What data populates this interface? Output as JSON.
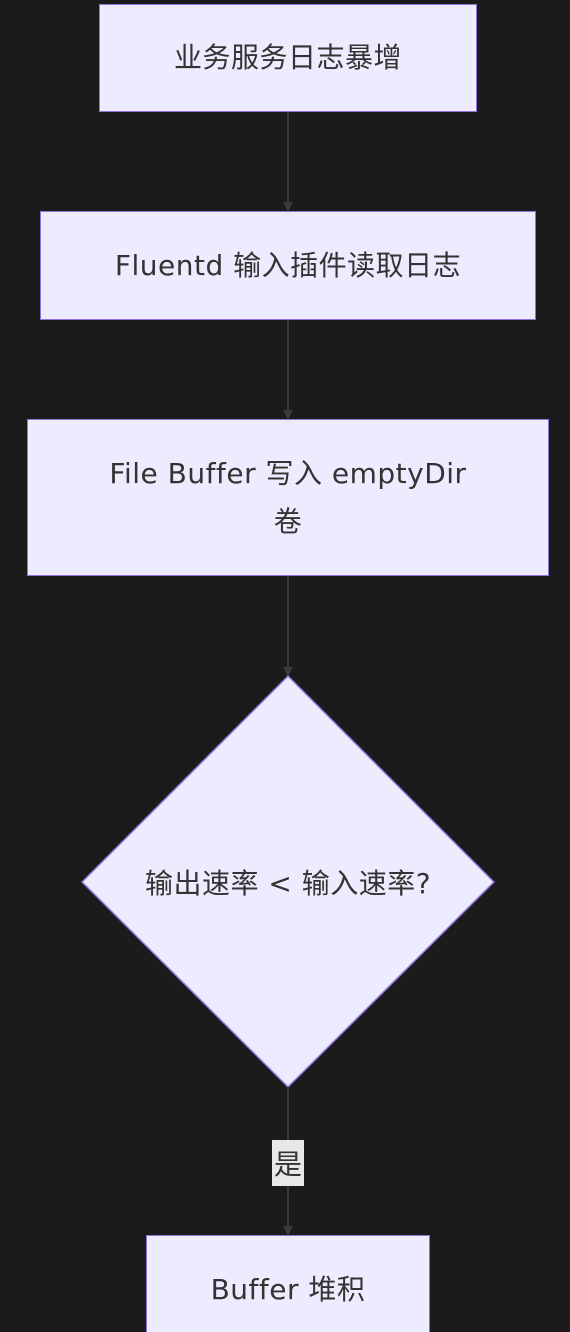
{
  "diagram": {
    "nodes": [
      {
        "id": "n1",
        "label": "业务服务日志暴增"
      },
      {
        "id": "n2",
        "label": "Fluentd 输入插件读取日志"
      },
      {
        "id": "n3",
        "label_line1": "File Buffer 写入 emptyDir",
        "label_line2": "卷"
      },
      {
        "id": "n4",
        "label": "输出速率 < 输入速率?"
      },
      {
        "id": "n5",
        "label": "Buffer 堆积"
      }
    ],
    "edges": [
      {
        "from": "n1",
        "to": "n2",
        "label": ""
      },
      {
        "from": "n2",
        "to": "n3",
        "label": ""
      },
      {
        "from": "n3",
        "to": "n4",
        "label": ""
      },
      {
        "from": "n4",
        "to": "n5",
        "label": "是"
      }
    ],
    "colors": {
      "background": "#1b1b1c",
      "node_fill": "#ececfe",
      "node_border": "#9370db",
      "text": "#333333",
      "edge": "#3a3a3a",
      "edge_label_bg": "#e8e8e8"
    }
  }
}
